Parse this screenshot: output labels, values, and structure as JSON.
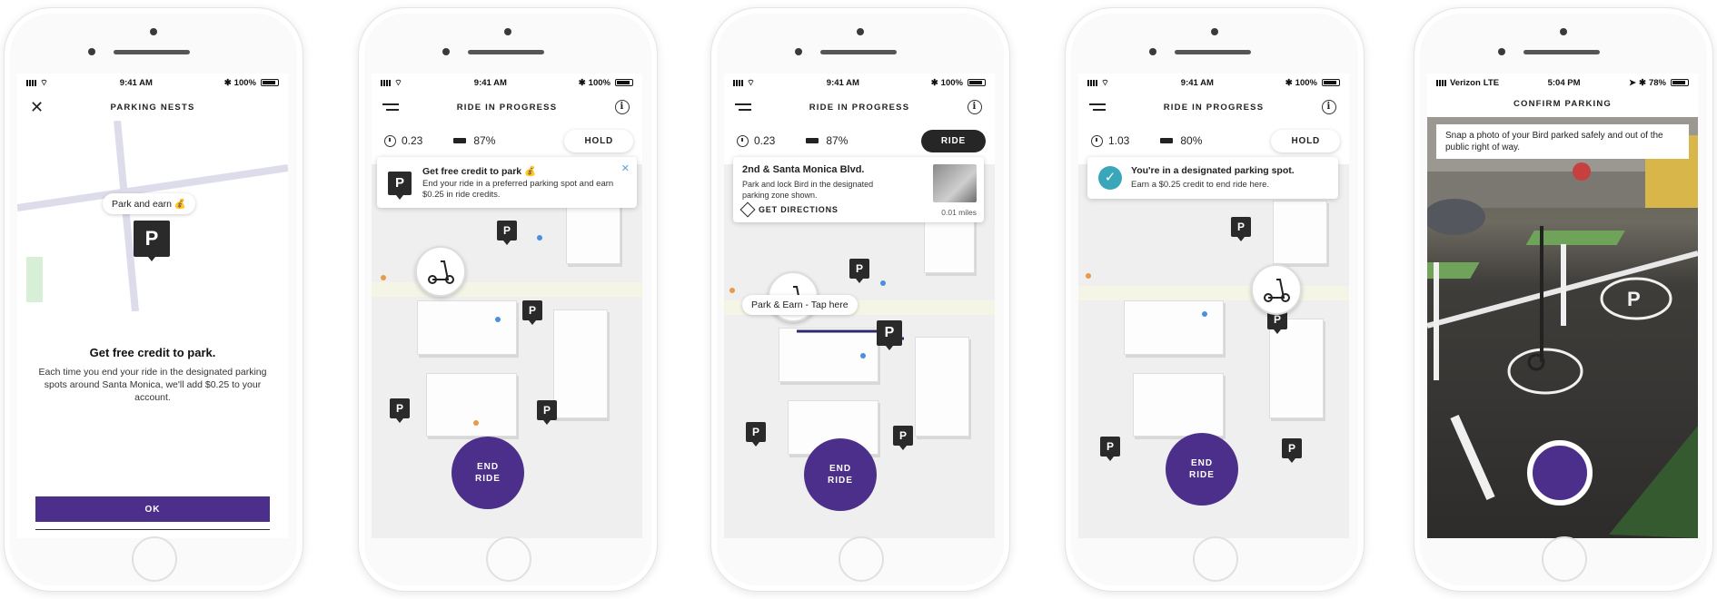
{
  "colors": {
    "brand_purple": "#4b2f8a",
    "dark": "#262626",
    "teal_check": "#3aa6b9",
    "map_bg": "#efefef"
  },
  "screen1": {
    "status": {
      "time": "9:41 AM",
      "battery": "100%"
    },
    "header_title": "PARKING NESTS",
    "close_icon": "close-icon",
    "map_tag": "Park and earn 💰",
    "headline": "Get free credit to park.",
    "body": "Each time you end your ride in the designated parking spots around Santa Monica, we'll add $0.25 to your account.",
    "ok_label": "OK"
  },
  "screen2": {
    "status": {
      "time": "9:41 AM",
      "battery": "100%"
    },
    "header_title": "RIDE IN PROGRESS",
    "distance": "0.23",
    "battery_pct": "87%",
    "action_label": "HOLD",
    "card_title": "Get free credit to park 💰",
    "card_body": "End your ride in a preferred parking spot and earn $0.25 in ride credits.",
    "end_ride": "END RIDE"
  },
  "screen3": {
    "status": {
      "time": "9:41 AM",
      "battery": "100%"
    },
    "header_title": "RIDE IN PROGRESS",
    "distance": "0.23",
    "battery_pct": "87%",
    "action_label": "RIDE",
    "card_title": "2nd & Santa Monica Blvd.",
    "card_body": "Park and lock Bird in the designated parking zone shown.",
    "directions_label": "GET DIRECTIONS",
    "miles": "0.01 miles",
    "map_tag": "Park & Earn - Tap here",
    "end_ride": "END RIDE"
  },
  "screen4": {
    "status": {
      "time": "9:41 AM",
      "battery": "100%"
    },
    "header_title": "RIDE IN PROGRESS",
    "distance": "1.03",
    "battery_pct": "80%",
    "action_label": "HOLD",
    "card_title": "You're in a designated parking spot.",
    "card_body": "Earn a $0.25 credit to end ride here.",
    "end_ride": "END RIDE"
  },
  "screen5": {
    "status": {
      "carrier": "Verizon",
      "network": "LTE",
      "time": "5:04 PM",
      "battery": "78%"
    },
    "header_title": "CONFIRM PARKING",
    "instruction": "Snap a photo of your Bird parked safely and out of the public right of way."
  }
}
